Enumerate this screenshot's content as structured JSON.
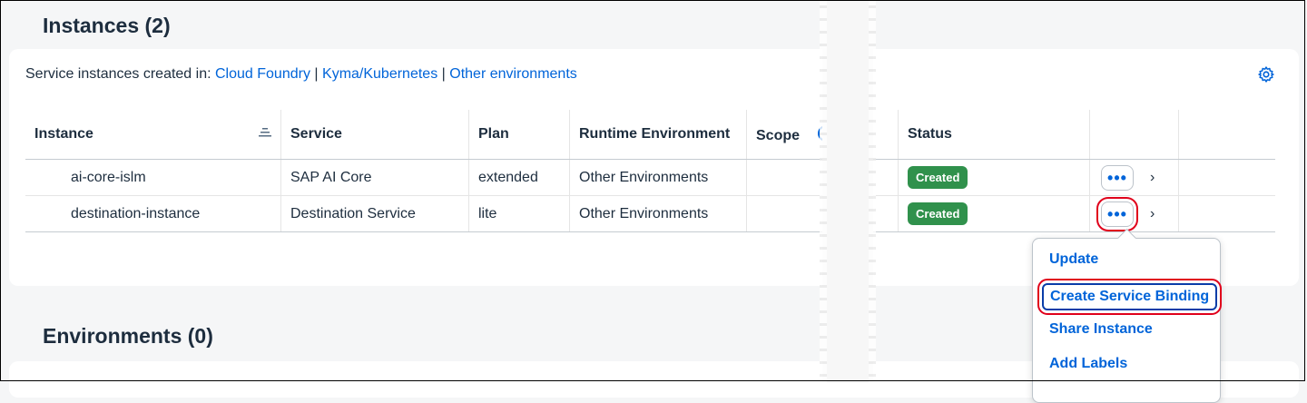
{
  "instances_section": {
    "title": "Instances (2)",
    "created_in_prefix": "Service instances created in:",
    "env_links": [
      "Cloud Foundry",
      "Kyma/Kubernetes",
      "Other environments"
    ],
    "separator": "|",
    "columns": [
      "Instance",
      "Service",
      "Plan",
      "Runtime Environment",
      "Scope",
      "Status"
    ],
    "rows": [
      {
        "instance": "ai-core-islm",
        "service": "SAP AI Core",
        "plan": "extended",
        "runtime": "Other Environments",
        "scope": "",
        "status": "Created"
      },
      {
        "instance": "destination-instance",
        "service": "Destination Service",
        "plan": "lite",
        "runtime": "Other Environments",
        "scope": "",
        "status": "Created"
      }
    ],
    "more_label": "•••",
    "chevron": "›"
  },
  "environments_section": {
    "title": "Environments (0)"
  },
  "popover_menu": {
    "items": [
      "Update",
      "Create Service Binding",
      "Share Instance",
      "Add Labels"
    ]
  },
  "colors": {
    "link": "#0064d9",
    "status_created": "#30914c",
    "highlight": "#e0001b"
  }
}
